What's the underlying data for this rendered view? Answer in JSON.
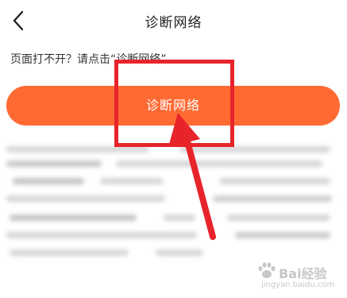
{
  "header": {
    "title": "诊断网络",
    "back_icon": "chevron-left-icon"
  },
  "hint": {
    "text": "页面打不开？请点击“诊断网络”"
  },
  "diagnose_button": {
    "label": "诊断网络",
    "color": "#ff6a33"
  },
  "annotation": {
    "color": "#e8242b"
  },
  "watermark": {
    "brand": "Bai经验",
    "url": "jingyan.baidu.com"
  }
}
